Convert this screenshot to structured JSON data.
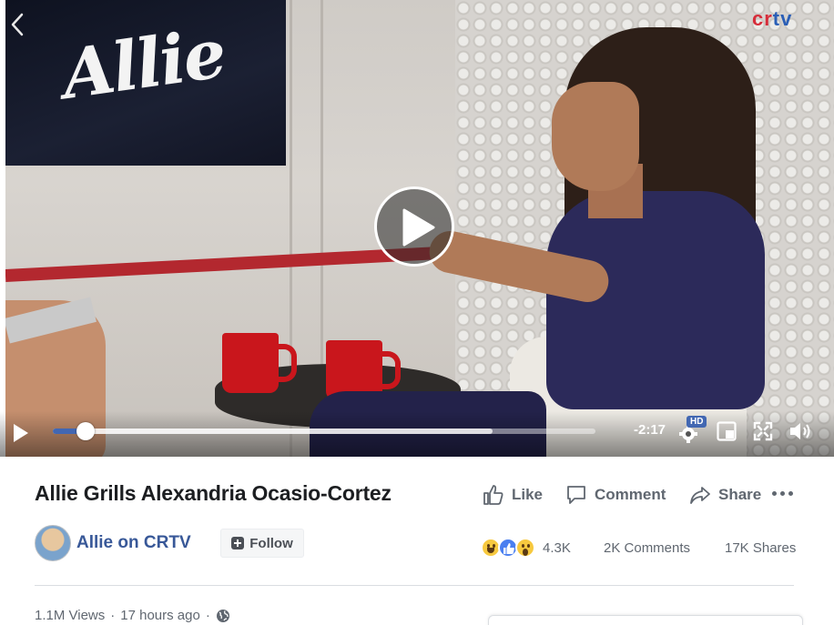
{
  "video": {
    "brand_logo": {
      "part1": "cr",
      "part2": "tv"
    },
    "screen_logo": "Allie",
    "controls": {
      "time_remaining": "-2:17",
      "hd_badge": "HD",
      "progress_played": 0.06,
      "progress_buffered": 0.81
    }
  },
  "post": {
    "title": "Allie Grills Alexandria Ocasio-Cortez",
    "actions": {
      "like": "Like",
      "comment": "Comment",
      "share": "Share"
    },
    "page_name": "Allie on CRTV",
    "follow_label": "Follow",
    "reactions": [
      "haha",
      "like",
      "wow"
    ],
    "reaction_count": "4.3K",
    "comments_count": "2K Comments",
    "shares_count": "17K Shares",
    "views": "1.1M Views",
    "separator": "·",
    "posted": "17 hours ago"
  },
  "colors": {
    "accent": "#4267b2",
    "link": "#385898",
    "muted_text": "#606770",
    "brand_red": "#d62d3a",
    "brand_blue": "#2b5fb6"
  },
  "icons": [
    "back-chevron-icon",
    "play-icon",
    "settings-gear-icon",
    "picture-in-picture-icon",
    "fullscreen-icon",
    "volume-icon",
    "thumbs-up-icon",
    "comment-bubble-icon",
    "share-arrow-icon",
    "more-dots-icon",
    "globe-icon"
  ]
}
